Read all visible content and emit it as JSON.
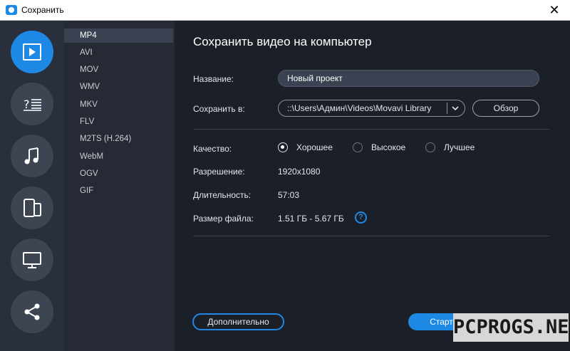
{
  "window": {
    "title": "Сохранить",
    "close_label": "✕"
  },
  "rail": {
    "items": [
      {
        "icon": "video-icon",
        "active": true
      },
      {
        "icon": "audio-format-icon",
        "active": false
      },
      {
        "icon": "music-icon",
        "active": false
      },
      {
        "icon": "devices-icon",
        "active": false
      },
      {
        "icon": "monitor-icon",
        "active": false
      },
      {
        "icon": "share-icon",
        "active": false
      }
    ]
  },
  "formats": {
    "items": [
      "MP4",
      "AVI",
      "MOV",
      "WMV",
      "MKV",
      "FLV",
      "M2TS (H.264)",
      "WebM",
      "OGV",
      "GIF"
    ],
    "selected": "MP4"
  },
  "main": {
    "heading": "Сохранить видео на компьютер",
    "name_label": "Название:",
    "name_value": "Новый проект",
    "save_to_label": "Сохранить в:",
    "save_to_value": "::\\Users\\Админ\\Videos\\Movavi Library",
    "browse_label": "Обзор",
    "quality_label": "Качество:",
    "quality_options": [
      "Хорошее",
      "Высокое",
      "Лучшее"
    ],
    "quality_selected": "Хорошее",
    "resolution_label": "Разрешение:",
    "resolution_value": "1920x1080",
    "duration_label": "Длительность:",
    "duration_value": "57:03",
    "filesize_label": "Размер файла:",
    "filesize_value": "1.51 ГБ - 5.67 ГБ",
    "help_label": "?",
    "more_label": "Дополнительно",
    "start_label": "Старт",
    "cancel_label": ""
  },
  "watermark": "PCPROGS.NET",
  "colors": {
    "accent": "#1e88e5",
    "background": "#1b1f27",
    "rail": "#2a303b",
    "list": "#252a34"
  }
}
